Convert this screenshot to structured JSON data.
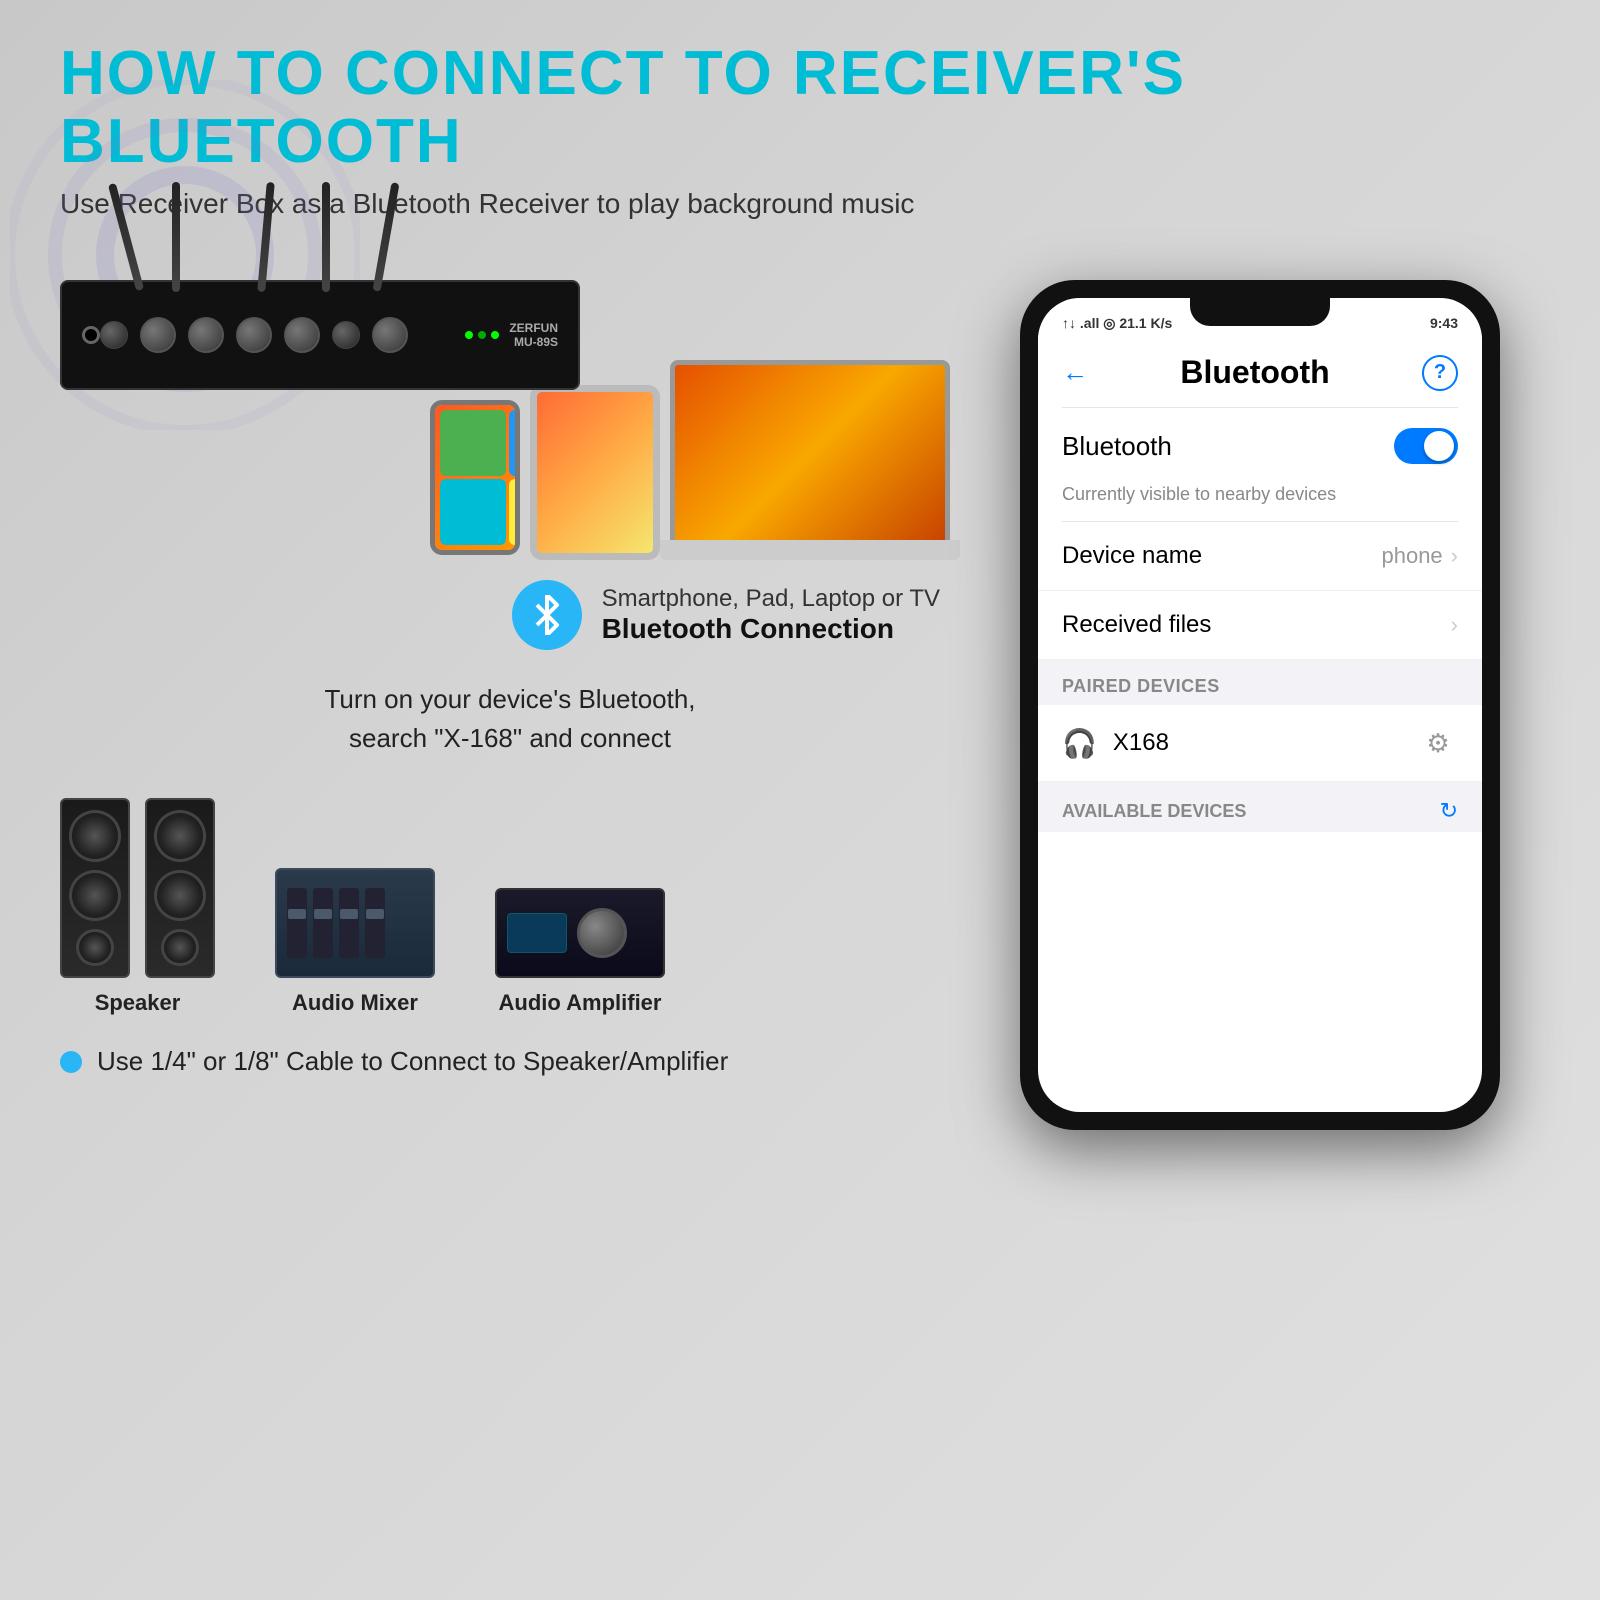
{
  "page": {
    "title": "HOW TO CONNECT TO RECEIVER'S BLUETOOTH",
    "subtitle": "Use Receiver Box as a Bluetooth Receiver to play background music",
    "bt_icon": "❄",
    "connection_line1": "Smartphone, Pad, Laptop or TV",
    "connection_line2": "Bluetooth Connection",
    "instruction": "Turn on your device's Bluetooth,\nsearch \"X-168\" and connect",
    "cable_note": "Use 1/4\" or 1/8\" Cable to Connect to Speaker/Amplifier"
  },
  "devices": {
    "speaker_label": "Speaker",
    "mixer_label": "Audio Mixer",
    "amplifier_label": "Audio Amplifier",
    "receiver_brand": "ZERFUN",
    "receiver_model": "MU-89S"
  },
  "phone_ui": {
    "status_left": "↑↓ .all ◎ 21.1 K/s",
    "status_right": "9:43",
    "screen_title": "Bluetooth",
    "back_label": "←",
    "help_label": "?",
    "bluetooth_toggle_label": "Bluetooth",
    "bluetooth_visible_text": "Currently visible to nearby devices",
    "device_name_label": "Device name",
    "device_name_value": "phone",
    "received_files_label": "Received files",
    "paired_devices_header": "PAIRED DEVICES",
    "paired_device_name": "X168",
    "available_header": "AVAILABLE DEVICES"
  },
  "icons": {
    "bluetooth": "bluetooth",
    "back_arrow": "back",
    "gear": "gear",
    "headphone": "headphone",
    "chevron": "chevron-right",
    "refresh": "refresh"
  }
}
